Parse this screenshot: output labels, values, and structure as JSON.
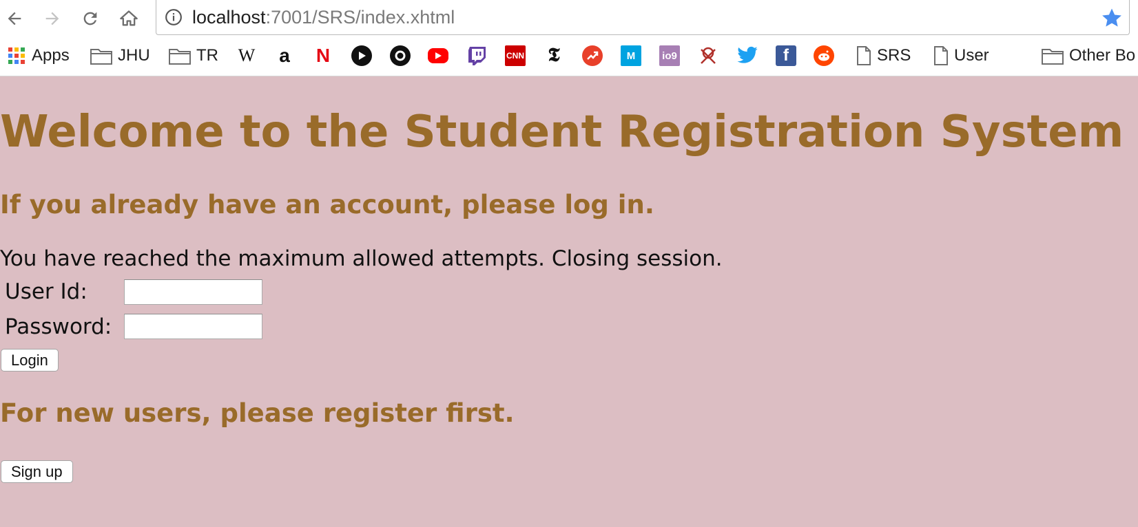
{
  "browser": {
    "url_host": "localhost",
    "url_path": ":7001/SRS/index.xhtml",
    "icons": [
      "back-arrow-icon",
      "forward-arrow-icon",
      "reload-icon",
      "home-icon",
      "info-icon",
      "bookmark-star-icon"
    ],
    "star_color": "#4a8ef0"
  },
  "bookmarks": {
    "apps_label": "Apps",
    "jhu_label": "JHU",
    "tr_label": "TR",
    "wikipedia_glyph": "W",
    "amazon_glyph": "a",
    "netflix_glyph": "N",
    "cnn_glyph": "CNN",
    "nyt_glyph": "𝕿",
    "medium_glyph": "M",
    "io9_glyph": "io9",
    "facebook_glyph": "f",
    "srs_label": "SRS",
    "user_label": "User",
    "other_label": "Other Bo"
  },
  "page": {
    "title": "Welcome to the Student Registration System",
    "login_heading": "If you already have an account, please log in.",
    "message": "You have reached the maximum allowed attempts. Closing session.",
    "user_id_label": "User Id:",
    "password_label": "Password:",
    "user_id_value": "",
    "password_value": "",
    "login_button": "Login",
    "register_heading": "For new users, please register first.",
    "signup_button": "Sign up",
    "heading_color": "#996b2a",
    "background_color": "#dcbec3"
  }
}
